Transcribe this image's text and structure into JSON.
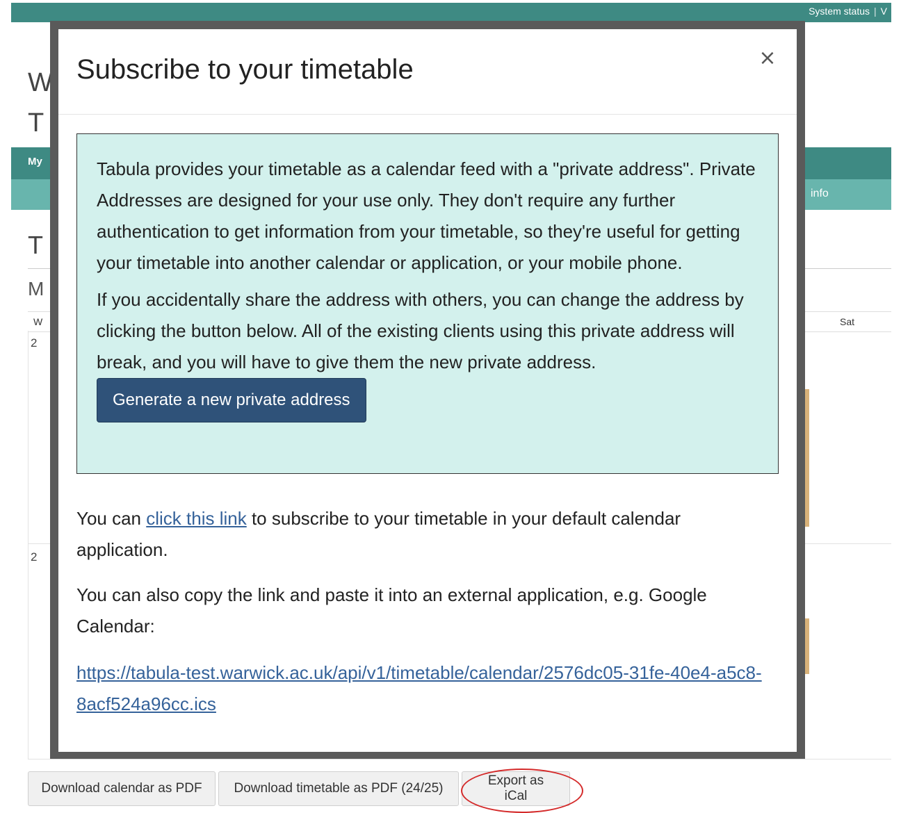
{
  "header": {
    "system_status": "System status",
    "separator": "|",
    "next_link_fragment": "V"
  },
  "background": {
    "heading_1_fragment": "W",
    "heading_2_fragment": "T",
    "nav_label_fragment": "My",
    "subnav_right_fragment": "info",
    "heading_3_fragment": "T",
    "heading_4_fragment": "M",
    "table_first_col_fragment": "W",
    "table_last_col": "Sat",
    "row_1_fragment": "2",
    "row_2_fragment": "2"
  },
  "modal": {
    "title": "Subscribe to your timetable",
    "close_symbol": "×",
    "info": {
      "paragraph_1": "Tabula provides your timetable as a calendar feed with a \"private address\". Private Addresses are designed for your use only. They don't require any further authentication to get information from your timetable, so they're useful for getting your timetable into another calendar or application, or your mobile phone.",
      "paragraph_2": "If you accidentally share the address with others, you can change the address by clicking the button below. All of the existing clients using this private address will break, and you will have to give them the new private address.",
      "generate_button": "Generate a new private address"
    },
    "subscribe_prefix": "You can ",
    "subscribe_link": "click this link",
    "subscribe_suffix": " to subscribe to your timetable in your default calendar application.",
    "copy_text": "You can also copy the link and paste it into an external application, e.g. Google Calendar:",
    "feed_url": "https://tabula-test.warwick.ac.uk/api/v1/timetable/calendar/2576dc05-31fe-40e4-a5c8-8acf524a96cc.ics"
  },
  "footer_buttons": {
    "download_calendar_pdf": "Download calendar as PDF",
    "download_timetable_pdf": "Download timetable as PDF (24/25)",
    "export_ical": "Export as iCal"
  },
  "colors": {
    "brand_teal": "#3e8a83",
    "brand_teal_light": "#68b5ad",
    "info_bg": "#d3f1ed",
    "primary_button": "#2f5279",
    "link": "#35629a",
    "highlight_circle": "#d42a2a"
  }
}
